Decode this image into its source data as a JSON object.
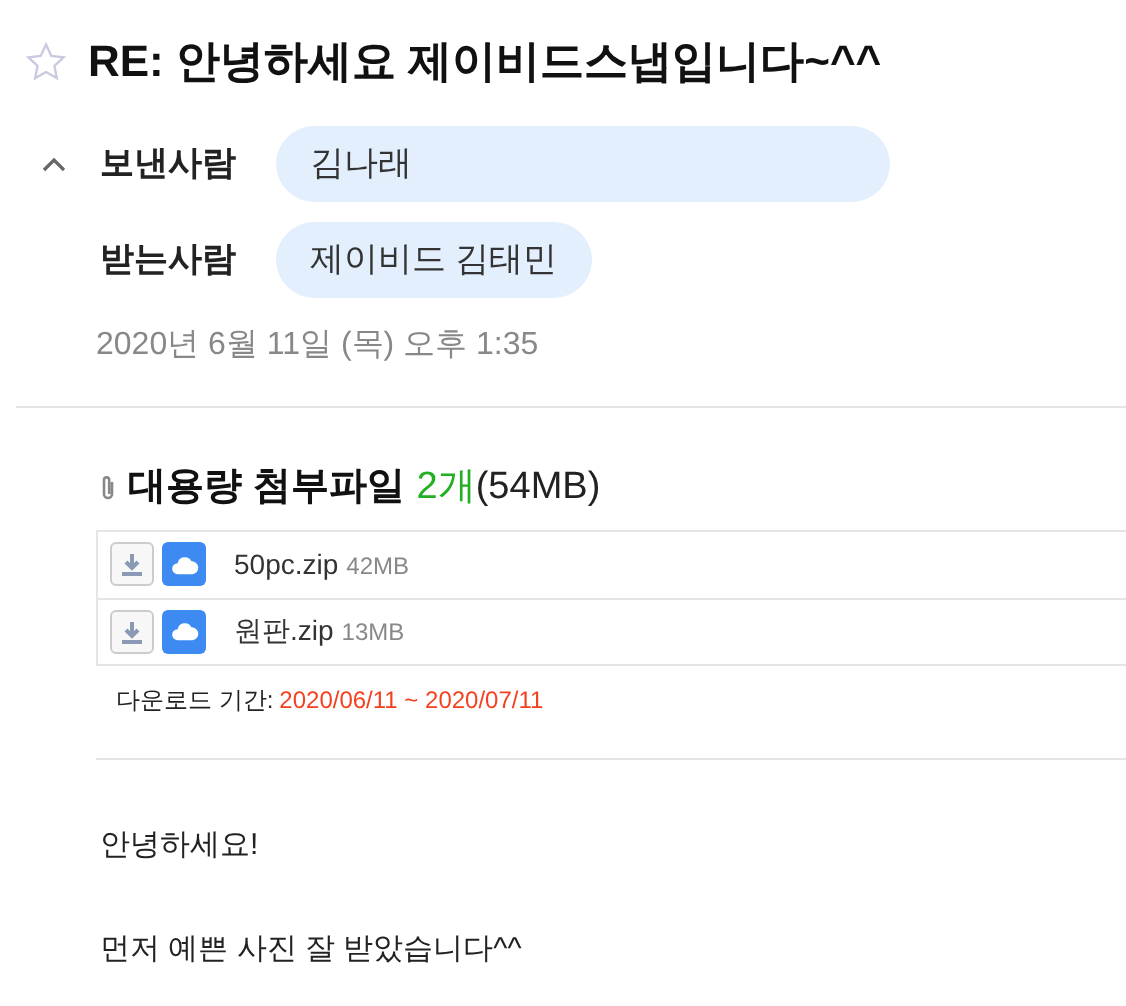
{
  "subject": {
    "title": "RE: 안녕하세요 제이비드스냅입니다~^^",
    "starred": false
  },
  "header": {
    "expanded": true,
    "sender": {
      "label": "보낸사람",
      "name": "김나래"
    },
    "recipient": {
      "label": "받는사람",
      "name": "제이비드 김태민"
    },
    "date": "2020년 6월 11일 (목) 오후 1:35"
  },
  "attachments": {
    "title": "대용량 첨부파일",
    "count": "2개",
    "total": "(54MB)",
    "files": [
      {
        "name": "50pc.zip",
        "size": "42MB"
      },
      {
        "name": "원판.zip",
        "size": "13MB"
      }
    ],
    "period_label": "다운로드 기간:",
    "period": "2020/06/11 ~ 2020/07/11"
  },
  "body": [
    "안녕하세요!",
    "먼저 예쁜 사진 잘 받았습니다^^"
  ]
}
